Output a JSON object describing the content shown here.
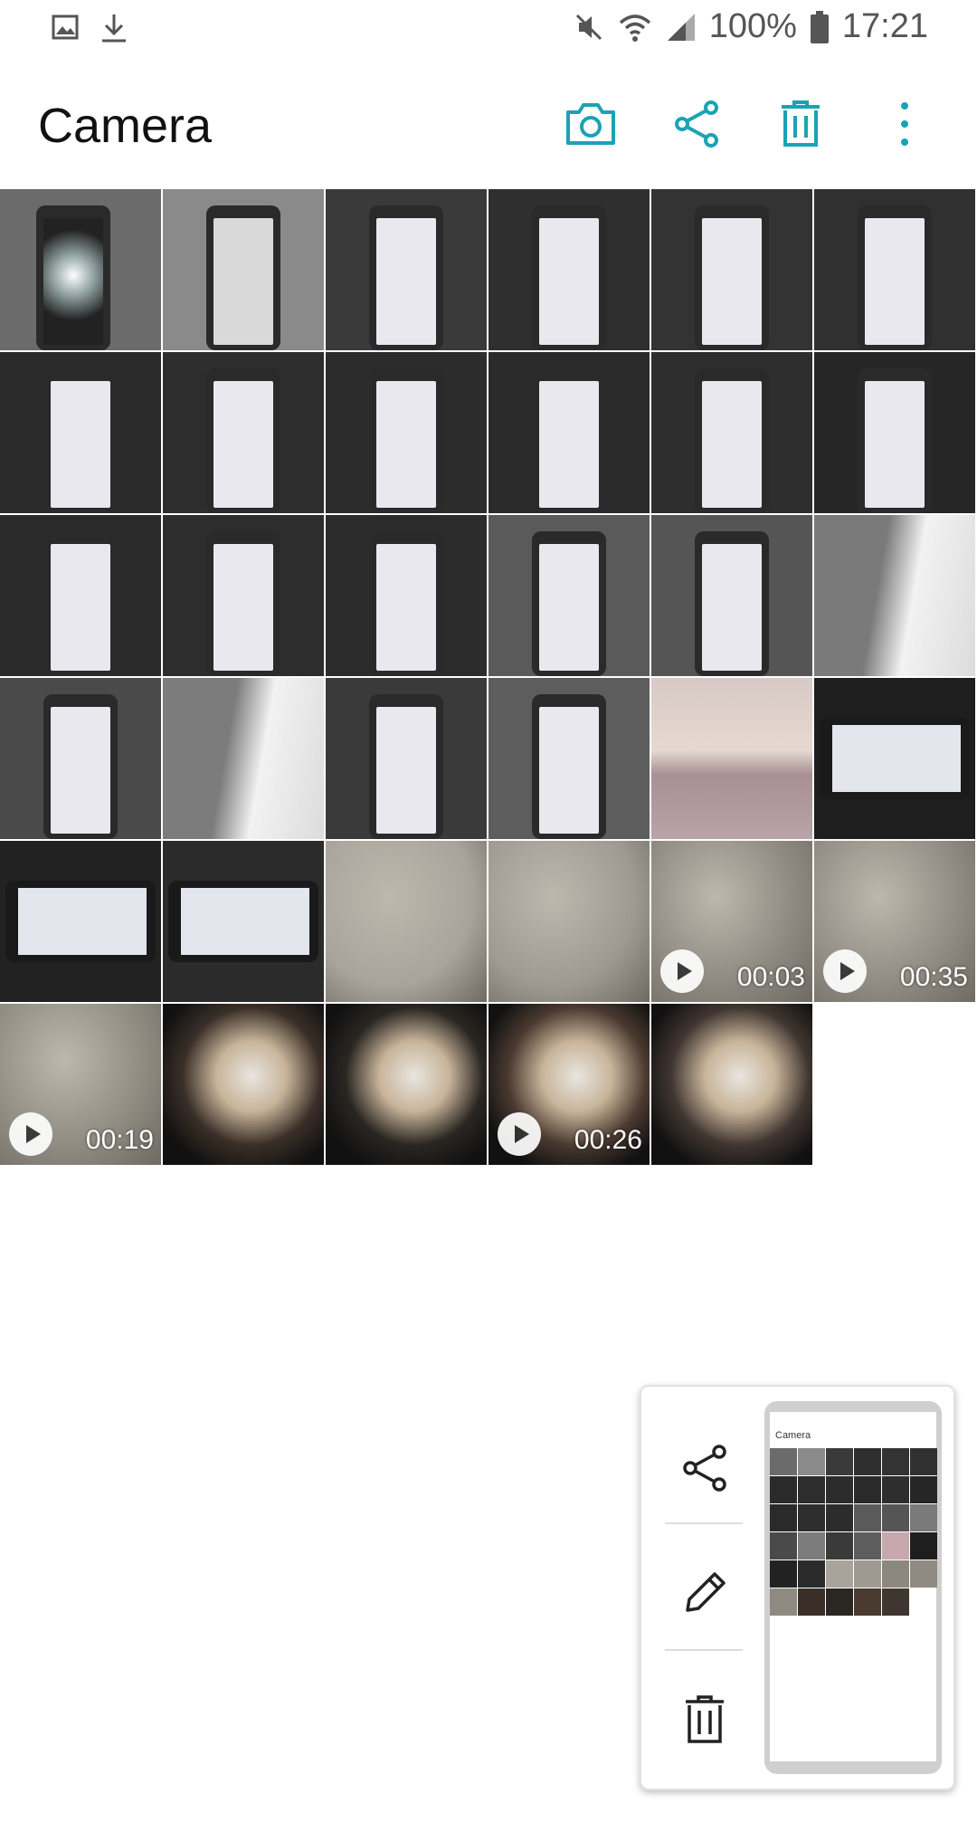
{
  "status_bar": {
    "battery": "100%",
    "time": "17:21"
  },
  "app_bar": {
    "title": "Camera",
    "actions": [
      "camera-icon",
      "share-icon",
      "delete-icon",
      "more-icon"
    ],
    "accent_color": "#1aa3b5"
  },
  "grid": {
    "items": [
      {
        "kind": "photo"
      },
      {
        "kind": "photo"
      },
      {
        "kind": "photo"
      },
      {
        "kind": "photo"
      },
      {
        "kind": "photo"
      },
      {
        "kind": "photo"
      },
      {
        "kind": "photo"
      },
      {
        "kind": "photo"
      },
      {
        "kind": "photo"
      },
      {
        "kind": "photo"
      },
      {
        "kind": "photo"
      },
      {
        "kind": "photo"
      },
      {
        "kind": "photo"
      },
      {
        "kind": "photo"
      },
      {
        "kind": "photo"
      },
      {
        "kind": "photo"
      },
      {
        "kind": "photo"
      },
      {
        "kind": "photo"
      },
      {
        "kind": "photo"
      },
      {
        "kind": "photo"
      },
      {
        "kind": "photo"
      },
      {
        "kind": "photo"
      },
      {
        "kind": "photo"
      },
      {
        "kind": "photo"
      },
      {
        "kind": "photo"
      },
      {
        "kind": "photo"
      },
      {
        "kind": "photo"
      },
      {
        "kind": "photo"
      },
      {
        "kind": "video",
        "duration": "00:03"
      },
      {
        "kind": "video",
        "duration": "00:35"
      },
      {
        "kind": "video",
        "duration": "00:19"
      },
      {
        "kind": "photo"
      },
      {
        "kind": "photo"
      },
      {
        "kind": "video",
        "duration": "00:26"
      },
      {
        "kind": "photo"
      }
    ]
  },
  "popup": {
    "actions": [
      "share-icon",
      "edit-icon",
      "delete-icon"
    ],
    "preview_title": "Camera"
  }
}
